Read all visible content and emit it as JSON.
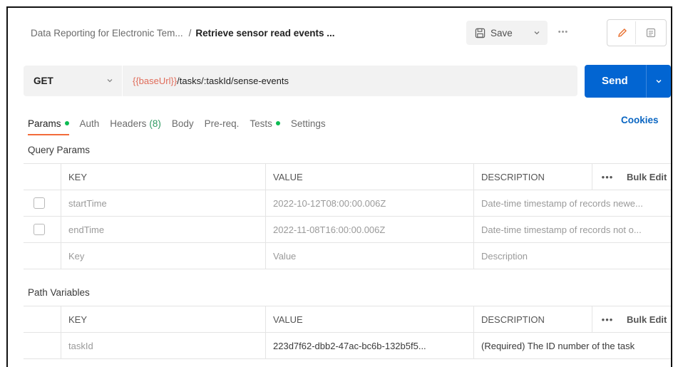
{
  "header": {
    "breadcrumb_parent": "Data Reporting for Electronic Tem...",
    "breadcrumb_separator": "/",
    "breadcrumb_current": "Retrieve sensor read events ...",
    "save_label": "Save",
    "save_icon": "floppy-disk-icon",
    "more_icon": "ellipsis-icon",
    "edit_icon": "pencil-icon",
    "doc_icon": "documentation-icon"
  },
  "request": {
    "method": "GET",
    "url_variable": "{{baseUrl}}",
    "url_path": "/tasks/:taskId/sense-events",
    "send_label": "Send"
  },
  "tabs": [
    {
      "label": "Params",
      "dot": true,
      "active": true
    },
    {
      "label": "Auth"
    },
    {
      "label": "Headers",
      "count": "(8)"
    },
    {
      "label": "Body"
    },
    {
      "label": "Pre-req."
    },
    {
      "label": "Tests",
      "dot": true
    },
    {
      "label": "Settings"
    }
  ],
  "cookies_label": "Cookies",
  "query_params": {
    "title": "Query Params",
    "headers": {
      "key": "KEY",
      "value": "VALUE",
      "description": "DESCRIPTION",
      "bulk_edit": "Bulk Edit"
    },
    "rows": [
      {
        "key": "startTime",
        "value": "2022-10-12T08:00:00.006Z",
        "description": "Date-time timestamp of records newe..."
      },
      {
        "key": "endTime",
        "value": "2022-11-08T16:00:00.006Z",
        "description": "Date-time timestamp of records not o..."
      }
    ],
    "placeholder": {
      "key": "Key",
      "value": "Value",
      "description": "Description"
    }
  },
  "path_variables": {
    "title": "Path Variables",
    "headers": {
      "key": "KEY",
      "value": "VALUE",
      "description": "DESCRIPTION",
      "bulk_edit": "Bulk Edit"
    },
    "rows": [
      {
        "key": "taskId",
        "value": "223d7f62-dbb2-47ac-bc6b-132b5f5...",
        "description": "(Required) The ID number of the task"
      }
    ]
  },
  "colors": {
    "accent_blue": "#0265d2",
    "active_tab_underline": "#f26b3a",
    "status_dot_green": "#0cbb52",
    "url_variable": "#e06c5a"
  }
}
